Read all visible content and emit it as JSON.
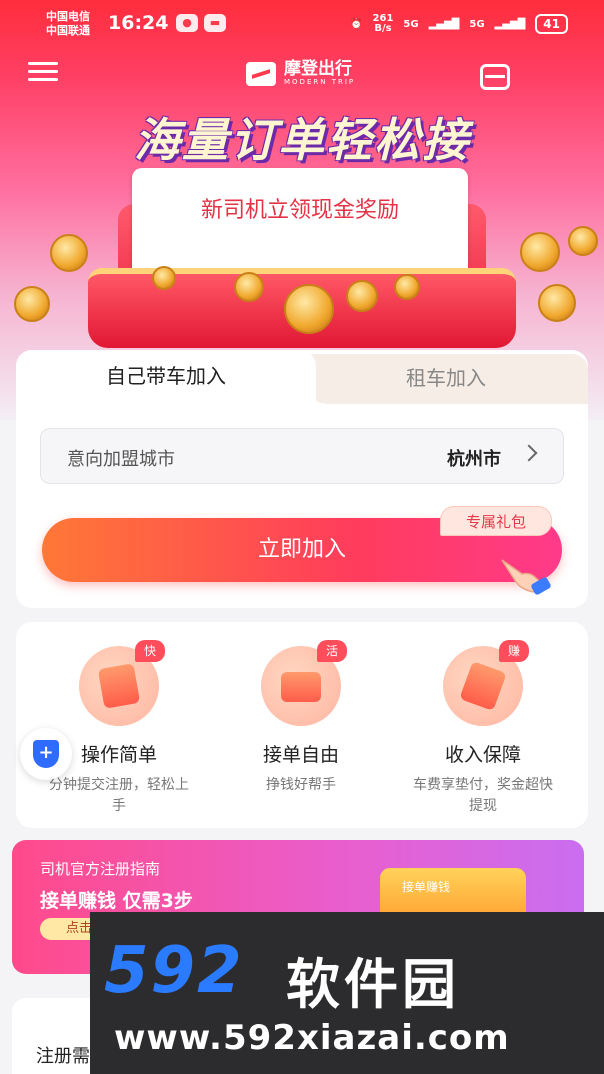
{
  "status_bar": {
    "carrier_1": "中国电信",
    "carrier_2": "中国联通",
    "time": "16:24",
    "net_speed_value": "261",
    "net_speed_unit": "B/s",
    "signal_1": "5G",
    "signal_2": "5G",
    "battery": "41"
  },
  "header": {
    "app_name": "摩登出行",
    "app_name_en": "MODERN TRIP"
  },
  "hero": {
    "headline": "海量订单轻松接",
    "card_text": "新司机立领现金奖励"
  },
  "join": {
    "tabs": [
      {
        "label": "自己带车加入",
        "active": true
      },
      {
        "label": "租车加入",
        "active": false
      }
    ],
    "city_label": "意向加盟城市",
    "city_value": "杭州市",
    "gift_badge": "专属礼包",
    "join_button": "立即加入"
  },
  "features": [
    {
      "tag": "快",
      "title": "操作简单",
      "desc": "分钟提交注册，轻松上手"
    },
    {
      "tag": "活",
      "title": "接单自由",
      "desc": "挣钱好帮手"
    },
    {
      "tag": "赚",
      "title": "收入保障",
      "desc": "车费享垫付，奖金超快提现"
    }
  ],
  "floating": {
    "shield_symbol": "+"
  },
  "guide": {
    "title": "司机官方注册指南",
    "subtitle": "接单赚钱 仅需3步",
    "button": "点击",
    "art_label": "接单赚钱"
  },
  "bottom": {
    "text": "注册需"
  },
  "watermark": {
    "logo": "592",
    "name": "软件园",
    "url": "www.592xiazai.com"
  },
  "colors": {
    "brand_red": "#ff2d3c",
    "button_gradient_start": "#ff7836",
    "button_gradient_end": "#ff3a8a",
    "watermark_blue": "#2a7bff"
  }
}
